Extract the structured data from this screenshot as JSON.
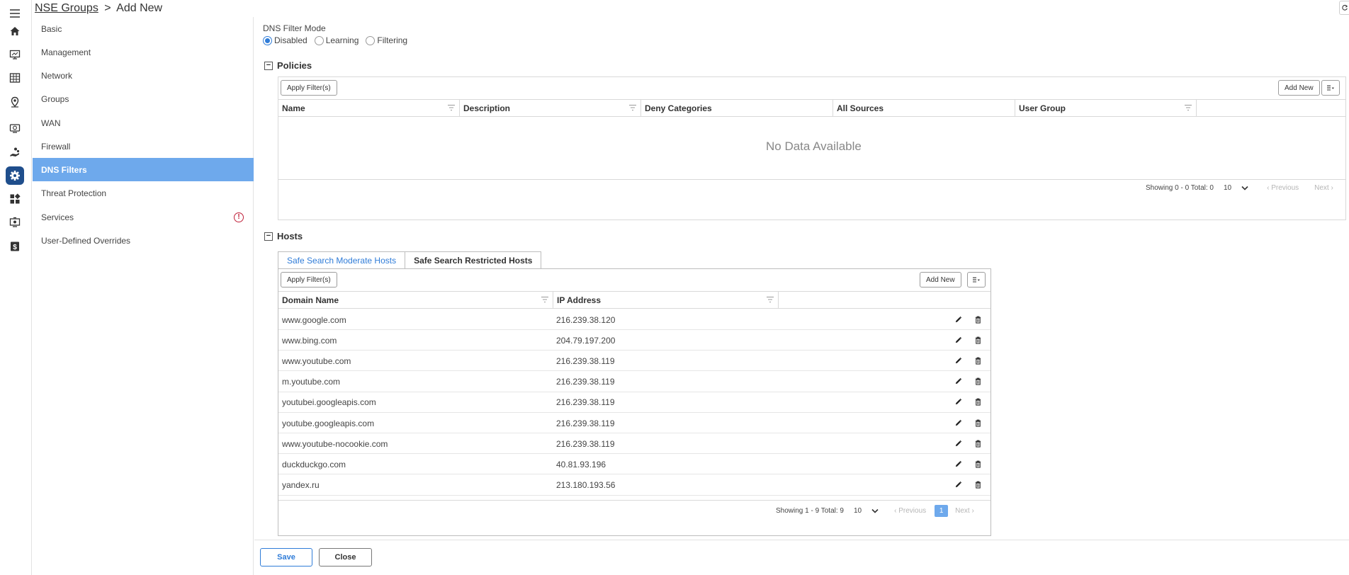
{
  "header": {
    "breadcrumb_link": "NSE Groups",
    "separator": ">",
    "current": "Add New"
  },
  "rail_icons": [
    "menu-icon",
    "home-icon",
    "monitor-icon",
    "table-icon",
    "location-pin-icon",
    "screen-sync-icon",
    "hand-people-icon",
    "gear-icon",
    "apps-grid-icon",
    "camera-monitor-icon",
    "dollar-icon"
  ],
  "nav": {
    "items": [
      {
        "label": "Basic"
      },
      {
        "label": "Management"
      },
      {
        "label": "Network"
      },
      {
        "label": "Groups"
      },
      {
        "label": "WAN"
      },
      {
        "label": "Firewall"
      },
      {
        "label": "DNS Filters"
      },
      {
        "label": "Threat Protection"
      },
      {
        "label": "Services",
        "badge": "!"
      },
      {
        "label": "User-Defined Overrides"
      }
    ],
    "active": "DNS Filters"
  },
  "dns_mode": {
    "label": "DNS Filter Mode",
    "options": [
      "Disabled",
      "Learning",
      "Filtering"
    ],
    "selected": "Disabled"
  },
  "policies": {
    "title": "Policies",
    "apply_filter": "Apply Filter(s)",
    "add_new": "Add New",
    "columns": [
      "Name",
      "Description",
      "Deny Categories",
      "All Sources",
      "User Group"
    ],
    "empty_text": "No Data Available",
    "pager": {
      "showing": "Showing 0 - 0 Total: 0",
      "page_size": "10",
      "previous": "Previous",
      "next": "Next"
    }
  },
  "hosts": {
    "title": "Hosts",
    "tabs": [
      "Safe Search Moderate Hosts",
      "Safe Search Restricted Hosts"
    ],
    "active_tab": "Safe Search Moderate Hosts",
    "apply_filter": "Apply Filter(s)",
    "add_new": "Add New",
    "columns": [
      "Domain Name",
      "IP Address"
    ],
    "rows": [
      {
        "domain": "www.google.com",
        "ip": "216.239.38.120"
      },
      {
        "domain": "www.bing.com",
        "ip": "204.79.197.200"
      },
      {
        "domain": "www.youtube.com",
        "ip": "216.239.38.119"
      },
      {
        "domain": "m.youtube.com",
        "ip": "216.239.38.119"
      },
      {
        "domain": "youtubei.googleapis.com",
        "ip": "216.239.38.119"
      },
      {
        "domain": "youtube.googleapis.com",
        "ip": "216.239.38.119"
      },
      {
        "domain": "www.youtube-nocookie.com",
        "ip": "216.239.38.119"
      },
      {
        "domain": "duckduckgo.com",
        "ip": "40.81.93.196"
      },
      {
        "domain": "yandex.ru",
        "ip": "213.180.193.56"
      }
    ],
    "pager": {
      "showing": "Showing 1 - 9 Total: 9",
      "page_size": "10",
      "previous": "Previous",
      "page": "1",
      "next": "Next"
    }
  },
  "footer": {
    "save": "Save",
    "close": "Close"
  },
  "colors": {
    "accent": "#2f7cd8",
    "nav_active": "#6ea9ec",
    "rail_active": "#1f4e8c",
    "warning": "#c0213a"
  }
}
